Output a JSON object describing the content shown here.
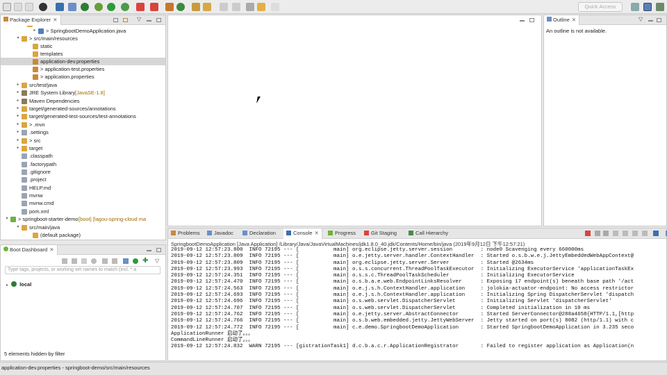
{
  "toolbar": {
    "quick_access": "Quick Access"
  },
  "package_explorer": {
    "tab_label": "Package Explorer",
    "tab2_icon": "hierarchy-icon",
    "rows": [
      {
        "label": "",
        "indent": 4,
        "twisty": ""
      },
      {
        "label": "> SpringbootDemoApplication.java",
        "indent": 6,
        "twisty": "▸"
      },
      {
        "label": "> src/main/resources",
        "indent": 3,
        "twisty": "▾"
      },
      {
        "label": "static",
        "indent": 5,
        "twisty": ""
      },
      {
        "label": "templates",
        "indent": 5,
        "twisty": ""
      },
      {
        "label": "application-dev.properties",
        "indent": 5,
        "twisty": "",
        "selected": true
      },
      {
        "label": "> application-test.properties",
        "indent": 5,
        "twisty": ""
      },
      {
        "label": "> application.properties",
        "indent": 5,
        "twisty": ""
      },
      {
        "label": "src/test/java",
        "indent": 3,
        "twisty": "▸"
      },
      {
        "label": "JRE System Library",
        "suffix": " [JavaSE-1.8]",
        "indent": 3,
        "twisty": "▸"
      },
      {
        "label": "Maven Dependencies",
        "indent": 3,
        "twisty": "▸"
      },
      {
        "label": "target/generated-sources/annotations",
        "indent": 3,
        "twisty": "▸"
      },
      {
        "label": "target/generated-test-sources/test-annotations",
        "indent": 3,
        "twisty": "▸"
      },
      {
        "label": "> .mvn",
        "indent": 3,
        "twisty": "▸"
      },
      {
        "label": ".settings",
        "indent": 3,
        "twisty": "▸"
      },
      {
        "label": "> src",
        "indent": 3,
        "twisty": "▸"
      },
      {
        "label": "target",
        "indent": 3,
        "twisty": "▸"
      },
      {
        "label": ".classpath",
        "indent": 3,
        "twisty": ""
      },
      {
        "label": ".factorypath",
        "indent": 3,
        "twisty": ""
      },
      {
        "label": ".gitignore",
        "indent": 3,
        "twisty": ""
      },
      {
        "label": ".project",
        "indent": 3,
        "twisty": ""
      },
      {
        "label": "HELP.md",
        "indent": 3,
        "twisty": ""
      },
      {
        "label": "mvnw",
        "indent": 3,
        "twisty": ""
      },
      {
        "label": "mvnw.cmd",
        "indent": 3,
        "twisty": ""
      },
      {
        "label": "pom.xml",
        "indent": 3,
        "twisty": ""
      },
      {
        "label": "> springboot-starter-demo",
        "suffix": " [boot] [lagou-spring-cloud ma",
        "indent": 1,
        "twisty": "▾"
      },
      {
        "label": "src/main/java",
        "indent": 3,
        "twisty": "▾"
      },
      {
        "label": "(default package)",
        "indent": 5,
        "twisty": ""
      }
    ]
  },
  "outline": {
    "tab_label": "Outline",
    "message": "An outline is not available."
  },
  "boot_dashboard": {
    "tab_label": "Boot Dashboard",
    "search_placeholder": "Type tags, projects, or working set names to match (incl. * a",
    "local_label": "local",
    "footer": "5 elements hidden by filter"
  },
  "console": {
    "tabs": [
      "Problems",
      "Javadoc",
      "Declaration",
      "Console",
      "Progress",
      "Git Staging",
      "Call Hierarchy"
    ],
    "active_tab": "Console",
    "header": "SpringbootDemoApplication [Java Application] /Library/Java/JavaVirtualMachines/jdk1.8.0_40.jdk/Contents/Home/bin/java (2019年9月12日 下午12:57:21)",
    "lines": [
      "2019-09-12 12:57:23.800  INFO 72195 --- [           main] org.eclipse.jetty.server.session         : node0 Scavenging every 660000ms",
      "2019-09-12 12:57:23.809  INFO 72195 --- [           main] o.e.jetty.server.handler.ContextHandler  : Started o.s.b.w.e.j.JettyEmbeddedWebAppContext@",
      "2019-09-12 12:57:23.809  INFO 72195 --- [           main] org.eclipse.jetty.server.Server          : Started @2634ms",
      "2019-09-12 12:57:23.993  INFO 72195 --- [           main] o.s.s.concurrent.ThreadPoolTaskExecutor  : Initializing ExecutorService 'applicationTaskEx",
      "2019-09-12 12:57:24.351  INFO 72195 --- [           main] o.s.s.c.ThreadPoolTaskScheduler          : Initializing ExecutorService",
      "2019-09-12 12:57:24.470  INFO 72195 --- [           main] o.s.b.a.e.web.EndpointLinksResolver      : Exposing 17 endpoint(s) beneath base path '/act",
      "2019-09-12 12:57:24.563  INFO 72195 --- [           main] o.e.j.s.h.ContextHandler.application     : jolokia-actuator-endpoint: No access restrictor",
      "2019-09-12 12:57:24.693  INFO 72195 --- [           main] o.e.j.s.h.ContextHandler.application     : Initializing Spring DispatcherServlet 'dispatch",
      "2019-09-12 12:57:24.696  INFO 72195 --- [           main] o.s.web.servlet.DispatcherServlet        : Initializing Servlet 'dispatcherServlet'",
      "2019-09-12 12:57:24.707  INFO 72195 --- [           main] o.s.web.servlet.DispatcherServlet        : Completed initialization in 10 ms",
      "2019-09-12 12:57:24.762  INFO 72195 --- [           main] o.e.jetty.server.AbstractConnector       : Started ServerConnector@288a4658{HTTP/1.1,[http",
      "2019-09-12 12:57:24.766  INFO 72195 --- [           main] o.s.b.web.embedded.jetty.JettyWebServer  : Jetty started on port(s) 8082 (http/1.1) with c",
      "2019-09-12 12:57:24.772  INFO 72195 --- [           main] c.e.demo.SpringbootDemoApplication       : Started SpringbootDemoApplication in 3.235 seco",
      "ApplicationRunner 启动了。。。",
      "CommandLineRunner 启动了。。。",
      "2019-09-12 12:57:24.832  WARN 72195 --- [gistrationTask1] d.c.b.a.c.r.ApplicationRegistrator       : Failed to register application as Application(n"
    ]
  },
  "status_bar": {
    "text": "application-dev.properties - springboot-demo/src/main/resources"
  },
  "colors": {
    "folder": "#d9a640",
    "package": "#c98a3a",
    "java": "#4f7fbd",
    "boot": "#6db33f",
    "accent": "#3a6fb0"
  }
}
